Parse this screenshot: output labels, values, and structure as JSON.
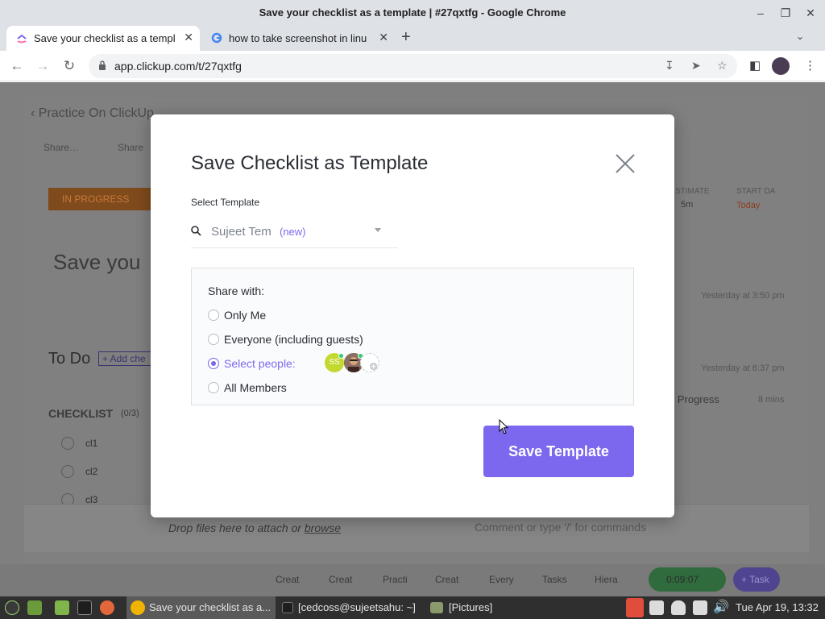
{
  "window": {
    "title": "Save your checklist as a template | #27qxtfg - Google Chrome"
  },
  "tabs": [
    {
      "label": "Save your checklist as a templ",
      "active": true
    },
    {
      "label": "how to take screenshot in linu",
      "active": false
    }
  ],
  "address": {
    "url": "app.clickup.com/t/27qxtfg"
  },
  "background": {
    "breadcrumb": "Practice On ClickUp",
    "crumb1": "Share…",
    "crumb2": "Share",
    "status": "IN PROGRESS",
    "task_title": "Save you",
    "estimate_label": "STIMATE",
    "estimate_value": "5m",
    "start_label": "START DA",
    "start_value": "Today",
    "activity1": "Yesterday at 3:50 pm",
    "activity2": "Yesterday at 6:37 pm",
    "in_progress": "n Progress",
    "mins": "8 mins",
    "todo": "To Do",
    "add_checklist": "+ Add che",
    "checklist_title": "CHECKLIST",
    "checklist_count": "(0/3)",
    "items": [
      "cl1",
      "cl2",
      "cl3"
    ],
    "drop_text": "Drop files here to attach or",
    "browse": "browse",
    "comment_placeholder": "Comment or type '/' for commands",
    "timer": "0:09:07",
    "task_btn": "+ Task",
    "footer_tabs": [
      "Creat",
      "Creat",
      "Practi",
      "Creat",
      "Every",
      "Tasks",
      "Hiera"
    ]
  },
  "modal": {
    "title": "Save Checklist as Template",
    "select_label": "Select Template",
    "template_name": "Sujeet Tem",
    "template_new": "(new)",
    "share_label": "Share with:",
    "options": [
      {
        "label": "Only Me",
        "selected": false
      },
      {
        "label": "Everyone (including guests)",
        "selected": false
      },
      {
        "label": "Select people:",
        "selected": true
      },
      {
        "label": "All Members",
        "selected": false
      }
    ],
    "avatar_initials": "SS",
    "save_button": "Save Template"
  },
  "taskbar": {
    "items": [
      "Save your checklist as a...",
      "[cedcoss@sujeetsahu: ~]",
      "[Pictures]"
    ],
    "clock": "Tue Apr 19, 13:32"
  },
  "colors": {
    "accent": "#7b68ee",
    "status": "#e57c24"
  }
}
